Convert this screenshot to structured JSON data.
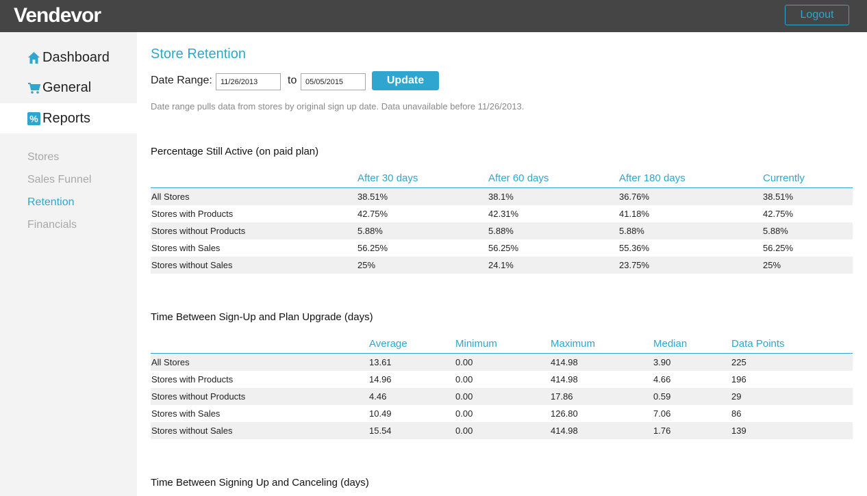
{
  "app": {
    "logo": "Vendevor",
    "logout_label": "Logout"
  },
  "sidebar": {
    "nav": [
      {
        "label": "Dashboard",
        "icon": "home-icon"
      },
      {
        "label": "General",
        "icon": "cart-icon"
      },
      {
        "label": "Reports",
        "icon": "percent-icon"
      }
    ],
    "subnav": [
      "Stores",
      "Sales Funnel",
      "Retention",
      "Financials"
    ]
  },
  "main": {
    "title": "Store Retention",
    "date_range_label": "Date Range:",
    "start_date": "11/26/2013",
    "to_label": "to",
    "end_date": "05/05/2015",
    "update_label": "Update",
    "note": "Date range pulls data from stores by original sign up date. Data unavailable before 11/26/2013."
  },
  "colors": {
    "accent": "#2ea6cf",
    "topbar": "#454545",
    "sidebar": "#f3f3f3"
  },
  "table1": {
    "title": "Percentage Still Active (on paid plan)",
    "headers": [
      "After 30 days",
      "After 60 days",
      "After 180 days",
      "Currently"
    ],
    "rows": [
      [
        "All Stores",
        "38.51%",
        "38.1%",
        "36.76%",
        "38.51%"
      ],
      [
        "Stores with Products",
        "42.75%",
        "42.31%",
        "41.18%",
        "42.75%"
      ],
      [
        "Stores without Products",
        "5.88%",
        "5.88%",
        "5.88%",
        "5.88%"
      ],
      [
        "Stores with Sales",
        "56.25%",
        "56.25%",
        "55.36%",
        "56.25%"
      ],
      [
        "Stores without Sales",
        "25%",
        "24.1%",
        "23.75%",
        "25%"
      ]
    ]
  },
  "table2": {
    "title": "Time Between Sign-Up and Plan Upgrade (days)",
    "headers": [
      "Average",
      "Minimum",
      "Maximum",
      "Median",
      "Data Points"
    ],
    "rows": [
      [
        "All Stores",
        "13.61",
        "0.00",
        "414.98",
        "3.90",
        "225"
      ],
      [
        "Stores with Products",
        "14.96",
        "0.00",
        "414.98",
        "4.66",
        "196"
      ],
      [
        "Stores without Products",
        "4.46",
        "0.00",
        "17.86",
        "0.59",
        "29"
      ],
      [
        "Stores with Sales",
        "10.49",
        "0.00",
        "126.80",
        "7.06",
        "86"
      ],
      [
        "Stores without Sales",
        "15.54",
        "0.00",
        "414.98",
        "1.76",
        "139"
      ]
    ]
  },
  "table3": {
    "title": "Time Between Signing Up and Canceling (days)"
  }
}
